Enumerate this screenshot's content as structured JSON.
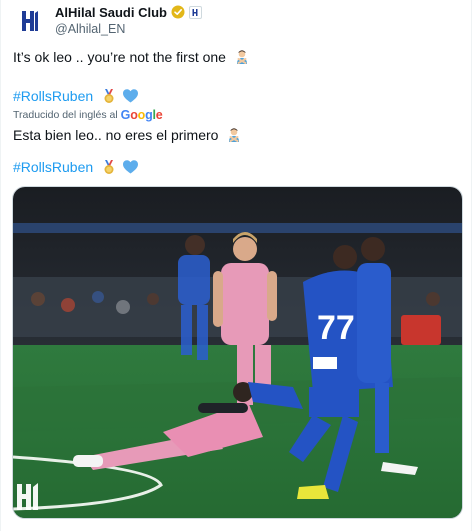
{
  "account": {
    "display_name": "AlHilal Saudi Club",
    "handle": "@Alhilal_EN",
    "avatar_icon": "alhilal-logo-icon",
    "verified_icon": "verified-gold-badge-icon",
    "affiliation_icon": "affiliate-badge-icon",
    "brand_color": "#1f3c96"
  },
  "tweet": {
    "line1_text": "It’s ok leo .. you’re not the first one",
    "line1_emoji": "man-gesturing-no-emoji",
    "hashtag1": "#RollsRuben",
    "hashtag1_emojis": [
      "medal-emoji",
      "blue-heart-emoji"
    ],
    "translation_label": "Traducido del inglés al",
    "translation_provider": "Google",
    "translated_text": "Esta bien leo.. no eres el primero",
    "translated_emoji": "man-gesturing-no-emoji",
    "hashtag2": "#RollsRuben",
    "hashtag2_emojis": [
      "medal-emoji",
      "blue-heart-emoji"
    ]
  },
  "media": {
    "type": "photo",
    "subject": "football-match-photo",
    "watermark_icon": "alhilal-watermark-icon",
    "jersey_number": "77",
    "colors": {
      "pitch": "#2f7a3e",
      "home_kit": "#2453c4",
      "away_kit": "#e89ab8"
    }
  }
}
